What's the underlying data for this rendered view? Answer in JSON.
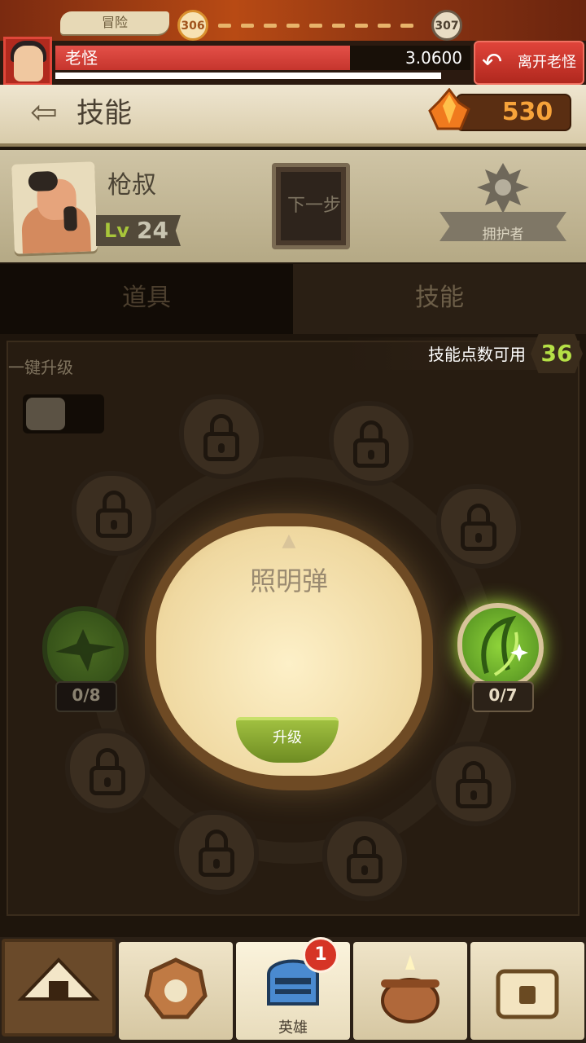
{
  "top_bar": {
    "mode_label": "冒险",
    "current_stage": "306",
    "next_stage": "307"
  },
  "boss": {
    "name": "老怪",
    "hp": "3.0600",
    "hp_fraction": 0.71,
    "timer_fraction": 0.93,
    "leave_label": "离开老怪"
  },
  "header": {
    "title": "技能",
    "gems": "530"
  },
  "hero": {
    "name": "枪叔",
    "level_label": "Lv",
    "level": "24",
    "next_step_label": "下一步",
    "role_label": "拥护者"
  },
  "tabs": {
    "items_label": "道具",
    "skills_label": "技能"
  },
  "skills_panel": {
    "points_label": "技能点数可用",
    "points": "36",
    "auto_upgrade_label": "一键升级",
    "auto_upgrade_on": false,
    "selected_skill": "照明弹",
    "upgrade_label": "升级",
    "skills": [
      {
        "icon": "eagle-icon",
        "count": "0/8"
      },
      {
        "icon": "flare-leaf-icon",
        "count": "0/7"
      }
    ]
  },
  "bottom_nav": {
    "items": [
      {
        "icon": "camp-tent-icon"
      },
      {
        "icon": "gear-token-icon"
      },
      {
        "icon": "knight-helmet-icon",
        "label": "英雄",
        "badge": "1"
      },
      {
        "icon": "cauldron-icon"
      },
      {
        "icon": "treasure-chest-icon"
      }
    ]
  },
  "colors": {
    "accent_green": "#b5e046",
    "gem_orange": "#f7a33a",
    "danger_red": "#d63426"
  }
}
